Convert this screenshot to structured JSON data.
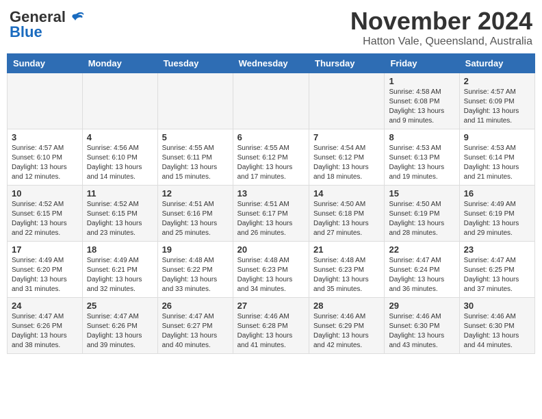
{
  "header": {
    "logo_general": "General",
    "logo_blue": "Blue",
    "month_title": "November 2024",
    "location": "Hatton Vale, Queensland, Australia"
  },
  "days_of_week": [
    "Sunday",
    "Monday",
    "Tuesday",
    "Wednesday",
    "Thursday",
    "Friday",
    "Saturday"
  ],
  "weeks": [
    [
      {
        "day": "",
        "info": ""
      },
      {
        "day": "",
        "info": ""
      },
      {
        "day": "",
        "info": ""
      },
      {
        "day": "",
        "info": ""
      },
      {
        "day": "",
        "info": ""
      },
      {
        "day": "1",
        "info": "Sunrise: 4:58 AM\nSunset: 6:08 PM\nDaylight: 13 hours and 9 minutes."
      },
      {
        "day": "2",
        "info": "Sunrise: 4:57 AM\nSunset: 6:09 PM\nDaylight: 13 hours and 11 minutes."
      }
    ],
    [
      {
        "day": "3",
        "info": "Sunrise: 4:57 AM\nSunset: 6:10 PM\nDaylight: 13 hours and 12 minutes."
      },
      {
        "day": "4",
        "info": "Sunrise: 4:56 AM\nSunset: 6:10 PM\nDaylight: 13 hours and 14 minutes."
      },
      {
        "day": "5",
        "info": "Sunrise: 4:55 AM\nSunset: 6:11 PM\nDaylight: 13 hours and 15 minutes."
      },
      {
        "day": "6",
        "info": "Sunrise: 4:55 AM\nSunset: 6:12 PM\nDaylight: 13 hours and 17 minutes."
      },
      {
        "day": "7",
        "info": "Sunrise: 4:54 AM\nSunset: 6:12 PM\nDaylight: 13 hours and 18 minutes."
      },
      {
        "day": "8",
        "info": "Sunrise: 4:53 AM\nSunset: 6:13 PM\nDaylight: 13 hours and 19 minutes."
      },
      {
        "day": "9",
        "info": "Sunrise: 4:53 AM\nSunset: 6:14 PM\nDaylight: 13 hours and 21 minutes."
      }
    ],
    [
      {
        "day": "10",
        "info": "Sunrise: 4:52 AM\nSunset: 6:15 PM\nDaylight: 13 hours and 22 minutes."
      },
      {
        "day": "11",
        "info": "Sunrise: 4:52 AM\nSunset: 6:15 PM\nDaylight: 13 hours and 23 minutes."
      },
      {
        "day": "12",
        "info": "Sunrise: 4:51 AM\nSunset: 6:16 PM\nDaylight: 13 hours and 25 minutes."
      },
      {
        "day": "13",
        "info": "Sunrise: 4:51 AM\nSunset: 6:17 PM\nDaylight: 13 hours and 26 minutes."
      },
      {
        "day": "14",
        "info": "Sunrise: 4:50 AM\nSunset: 6:18 PM\nDaylight: 13 hours and 27 minutes."
      },
      {
        "day": "15",
        "info": "Sunrise: 4:50 AM\nSunset: 6:19 PM\nDaylight: 13 hours and 28 minutes."
      },
      {
        "day": "16",
        "info": "Sunrise: 4:49 AM\nSunset: 6:19 PM\nDaylight: 13 hours and 29 minutes."
      }
    ],
    [
      {
        "day": "17",
        "info": "Sunrise: 4:49 AM\nSunset: 6:20 PM\nDaylight: 13 hours and 31 minutes."
      },
      {
        "day": "18",
        "info": "Sunrise: 4:49 AM\nSunset: 6:21 PM\nDaylight: 13 hours and 32 minutes."
      },
      {
        "day": "19",
        "info": "Sunrise: 4:48 AM\nSunset: 6:22 PM\nDaylight: 13 hours and 33 minutes."
      },
      {
        "day": "20",
        "info": "Sunrise: 4:48 AM\nSunset: 6:23 PM\nDaylight: 13 hours and 34 minutes."
      },
      {
        "day": "21",
        "info": "Sunrise: 4:48 AM\nSunset: 6:23 PM\nDaylight: 13 hours and 35 minutes."
      },
      {
        "day": "22",
        "info": "Sunrise: 4:47 AM\nSunset: 6:24 PM\nDaylight: 13 hours and 36 minutes."
      },
      {
        "day": "23",
        "info": "Sunrise: 4:47 AM\nSunset: 6:25 PM\nDaylight: 13 hours and 37 minutes."
      }
    ],
    [
      {
        "day": "24",
        "info": "Sunrise: 4:47 AM\nSunset: 6:26 PM\nDaylight: 13 hours and 38 minutes."
      },
      {
        "day": "25",
        "info": "Sunrise: 4:47 AM\nSunset: 6:26 PM\nDaylight: 13 hours and 39 minutes."
      },
      {
        "day": "26",
        "info": "Sunrise: 4:47 AM\nSunset: 6:27 PM\nDaylight: 13 hours and 40 minutes."
      },
      {
        "day": "27",
        "info": "Sunrise: 4:46 AM\nSunset: 6:28 PM\nDaylight: 13 hours and 41 minutes."
      },
      {
        "day": "28",
        "info": "Sunrise: 4:46 AM\nSunset: 6:29 PM\nDaylight: 13 hours and 42 minutes."
      },
      {
        "day": "29",
        "info": "Sunrise: 4:46 AM\nSunset: 6:30 PM\nDaylight: 13 hours and 43 minutes."
      },
      {
        "day": "30",
        "info": "Sunrise: 4:46 AM\nSunset: 6:30 PM\nDaylight: 13 hours and 44 minutes."
      }
    ]
  ]
}
